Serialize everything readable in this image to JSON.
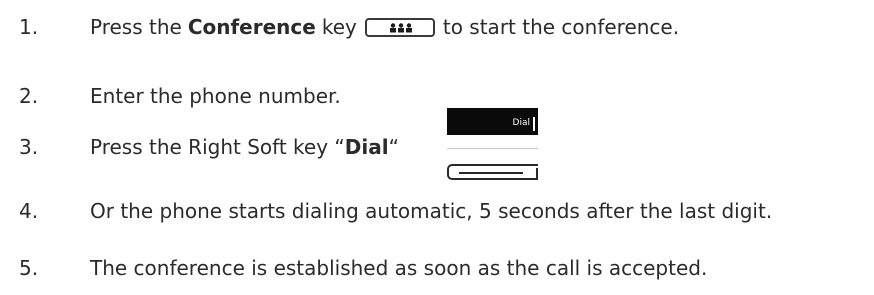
{
  "steps": [
    {
      "number": "1.",
      "before": "Press the",
      "bold": "Conference",
      "after_bold": "key",
      "after_key": "to start the conference."
    },
    {
      "number": "2.",
      "text": "Enter the phone number."
    },
    {
      "number": "3.",
      "before": "Press the Right Soft key “",
      "bold": "Dial",
      "after": "“"
    },
    {
      "number": "4.",
      "text": "Or the phone starts dialing automatic, 5 seconds after the last digit."
    },
    {
      "number": "5.",
      "text": "The conference is established as soon as the call is accepted."
    }
  ],
  "softkey": {
    "screen_label": "Dial"
  },
  "icons": {
    "conference_key": "conference-icon",
    "right_soft_key": "soft-key-icon"
  }
}
